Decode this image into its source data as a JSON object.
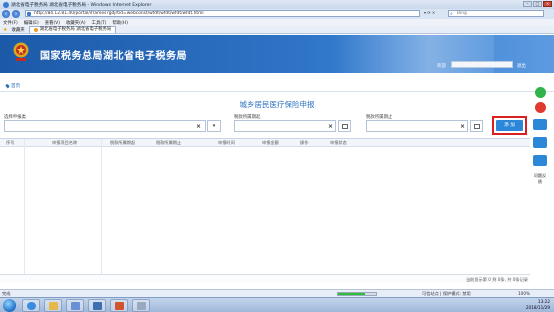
{
  "browser": {
    "window_title": "湖北省电子税务局 湖北省电子税务局 - Windows Internet Explorer",
    "address": "http://84.12.81.40/portal/iframes?gdjrtid=webconst/wfdt/wfdt/wfdt/wfdt.html",
    "search_placeholder": "Bing",
    "menu": [
      "文件(F)",
      "编辑(E)",
      "查看(V)",
      "收藏夹(A)",
      "工具(T)",
      "帮助(H)"
    ],
    "favorites_label": "收藏夹",
    "tab_label": "湖北省电子税务局 湖北省电子税务局",
    "status_text": "完成",
    "zone_text": "可信站点 | 保护模式: 禁用",
    "zoom_text": "100%",
    "progress": 0.7
  },
  "header": {
    "site_title": "国家税务总局湖北省电子税务局",
    "welcome": "欢迎",
    "logout": "退出"
  },
  "breadcrumb": {
    "home": "首页"
  },
  "page": {
    "title": "城乡居民医疗保险申报"
  },
  "form": {
    "field1_label": "选择申报类",
    "field2_label": "税款所属期起",
    "field3_label": "税款所属期止",
    "clear_glyph": "×",
    "dropdown_glyph": "▾",
    "add_button": "添 加"
  },
  "table": {
    "columns": [
      "序号",
      "申报项目名称",
      "税款所属期起",
      "税款所属期止",
      "申报时间",
      "申报金额",
      "操作",
      "申报状态"
    ],
    "footer": "当前显示第 0 到 0条, 共 0条记录"
  },
  "side_tools": {
    "label": "问题反馈"
  },
  "taskbar": {
    "time": "13:22",
    "date": "2018/11/29"
  },
  "colors": {
    "brand_blue": "#2a6fc2",
    "add_button": "#2d87d8",
    "highlight": "#d82020"
  }
}
